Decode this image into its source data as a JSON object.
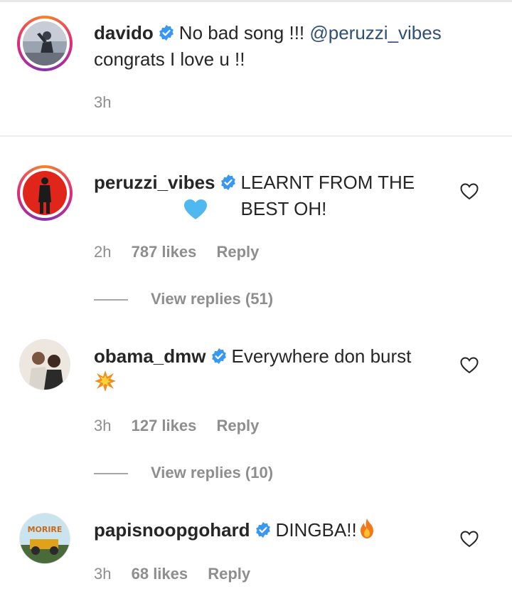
{
  "comments": [
    {
      "username": "davido",
      "text": "No bad song !!! ",
      "mention": "@peruzzi_vibes",
      "text_after": "congrats I love u !!",
      "time": "3h"
    },
    {
      "username": "peruzzi_vibes",
      "text": "LEARNT FROM THE BEST OH!",
      "time": "2h",
      "likes": "787 likes",
      "reply": "Reply",
      "view_replies": "View replies (51)"
    },
    {
      "username": "obama_dmw",
      "text": "Everywhere don burst",
      "time": "3h",
      "likes": "127 likes",
      "reply": "Reply",
      "view_replies": "View replies (10)"
    },
    {
      "username": "papisnoopgohard",
      "text": "DINGBA!!",
      "time": "3h",
      "likes": "68 likes",
      "reply": "Reply",
      "avatar_text": "MORIRE"
    }
  ],
  "colors": {
    "verified": "#3897f0",
    "heart_emoji": "#4fb8f0",
    "muted": "#8e8e8e"
  }
}
